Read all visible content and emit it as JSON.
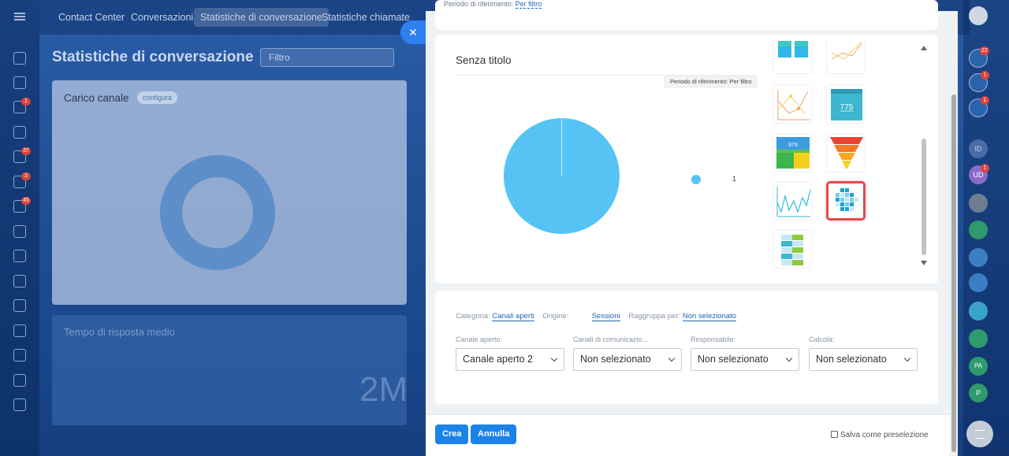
{
  "topnav": {
    "tabs": [
      "Contact Center",
      "Conversazioni",
      "Statistiche di conversazione",
      "Statistiche chiamate"
    ]
  },
  "background_page": {
    "title": "Statistiche di conversazione",
    "filter_placeholder": "Filtro",
    "card1_title": "Carico canale",
    "card1_configure": "configura",
    "card2_title": "Tempo di risposta medio",
    "card2_big_value": "2M"
  },
  "left_rail_badges": [
    "1",
    "37",
    "3",
    "45"
  ],
  "right_rail_badges": [
    "22",
    "1",
    "1",
    "1"
  ],
  "right_rail_avatars": [
    "ID",
    "UD",
    "PA",
    "P"
  ],
  "period_top": {
    "label": "Periodo di riferimento:",
    "value": "Per filtro"
  },
  "preview": {
    "widget_title": "Senza titolo",
    "period_tooltip": "Periodo di riferimento: Per filtro",
    "legend_value": "1",
    "pie_color": "#55c4f5"
  },
  "chart_types": {
    "selected": "heatmap",
    "tiles": [
      "number-blocks",
      "line-chart-orange",
      "line-chart-yellow",
      "number-775",
      "number-grid",
      "funnel",
      "line-chart-cyan",
      "heatmap",
      "bar-grid"
    ],
    "tile_775_value": "775",
    "tile_975_value": "975"
  },
  "filters": {
    "categoria_label": "Categoria:",
    "categoria_value": "Canali aperti",
    "origine_label": "Origine:",
    "origine_value": "Sessioni",
    "raggruppa_label": "Raggruppa per:",
    "raggruppa_value": "Non selezionato",
    "selects": [
      {
        "label": "Canale aperto:",
        "value": "Canale aperto 2"
      },
      {
        "label": "Canali di comunicazio...",
        "value": "Non selezionato"
      },
      {
        "label": "Responsabile:",
        "value": "Non selezionato"
      },
      {
        "label": "Calcola:",
        "value": "Non selezionato"
      }
    ]
  },
  "footer": {
    "create_label": "Crea",
    "cancel_label": "Annulla",
    "save_preset_label": "Salva come preselezione"
  },
  "colors": {
    "accent": "#1b82e8",
    "pie": "#55c4f5",
    "selection": "#e54b4b"
  }
}
